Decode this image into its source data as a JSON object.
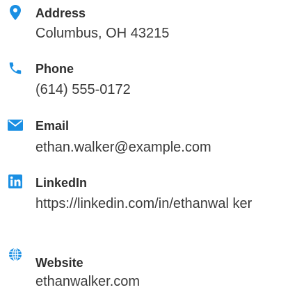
{
  "accent_color": "#1a8fe3",
  "contacts": [
    {
      "icon": "map-pin-icon",
      "label": "Address",
      "value": "Columbus, OH 43215"
    },
    {
      "icon": "phone-icon",
      "label": "Phone",
      "value": "(614) 555-0172"
    },
    {
      "icon": "envelope-icon",
      "label": "Email",
      "value": "ethan.walker@example.com"
    },
    {
      "icon": "linkedin-icon",
      "label": "LinkedIn",
      "value": "https://linkedin.com/in/ethanwal ker"
    },
    {
      "icon": "globe-icon",
      "label": "Website",
      "value": "ethanwalker.com"
    }
  ]
}
